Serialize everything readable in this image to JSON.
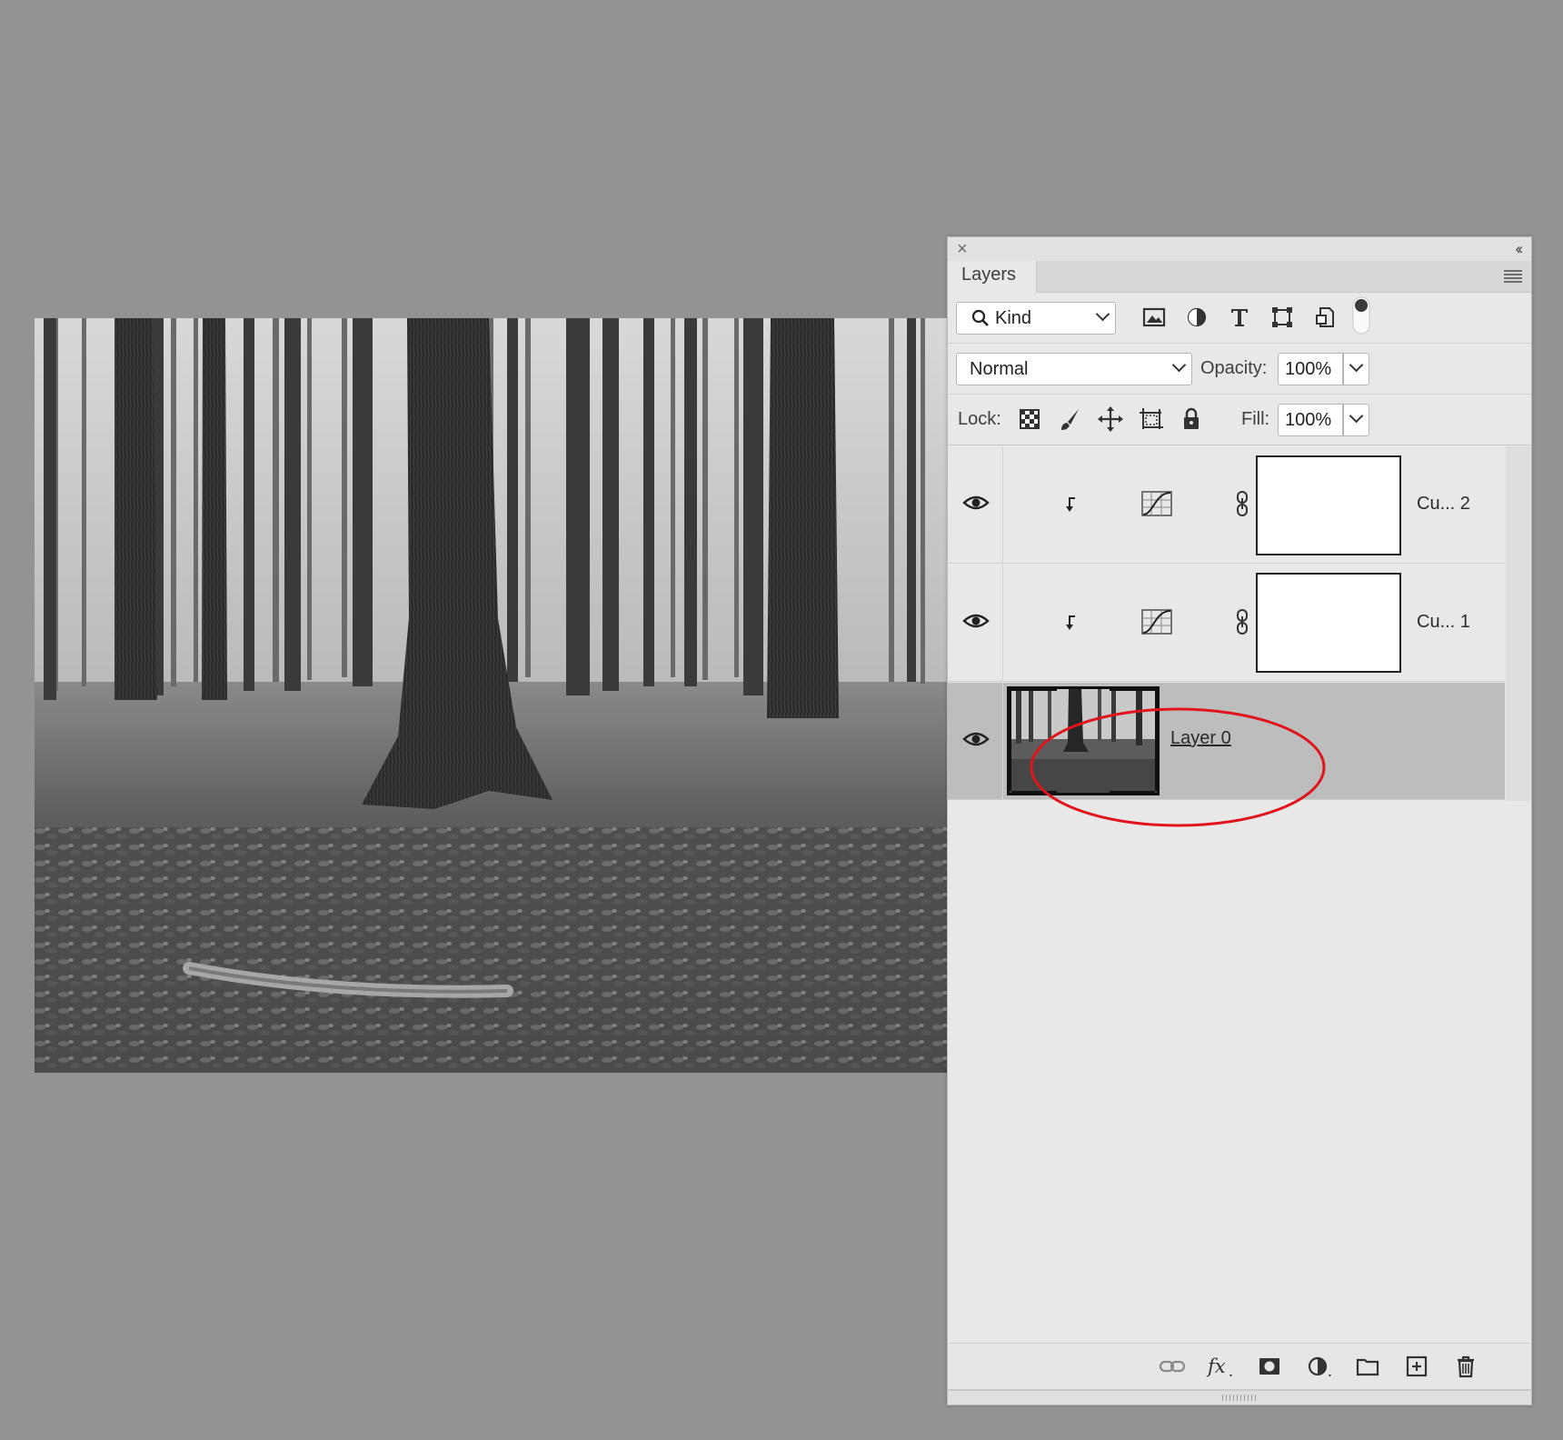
{
  "panel": {
    "tab_title": "Layers",
    "close_icon": "close-icon",
    "collapse_icon": "collapse-panel-icon",
    "menu_icon": "panel-menu-icon"
  },
  "filter": {
    "kind_label": "Kind",
    "filter_icons": [
      "image-filter-icon",
      "adjustment-filter-icon",
      "type-filter-icon",
      "shape-filter-icon",
      "smart-object-filter-icon",
      "filter-toggle-icon"
    ]
  },
  "blend": {
    "mode": "Normal",
    "opacity_label": "Opacity:",
    "opacity_value": "100%"
  },
  "lock": {
    "lock_label": "Lock:",
    "lock_icons": [
      "lock-transparent-pixels-icon",
      "lock-image-pixels-icon",
      "lock-position-icon",
      "lock-artboard-icon",
      "lock-all-icon"
    ],
    "fill_label": "Fill:",
    "fill_value": "100%"
  },
  "layers": [
    {
      "name": "Cu... 2",
      "type": "curves-adjustment",
      "visible": true,
      "clipped": true,
      "selected": false
    },
    {
      "name": "Cu... 1",
      "type": "curves-adjustment",
      "visible": true,
      "clipped": true,
      "selected": false
    },
    {
      "name": "Layer 0",
      "type": "smart-object",
      "visible": true,
      "clipped": false,
      "selected": true
    }
  ],
  "bottom_icons": [
    "link-layers-icon",
    "fx-icon",
    "add-mask-icon",
    "new-adjustment-icon",
    "new-group-icon",
    "new-layer-icon",
    "delete-layer-icon"
  ],
  "colors": {
    "background": "#939393",
    "panel": "#e8e8e8",
    "selected_row": "#bdbdbd",
    "annotation": "#e0151b"
  }
}
